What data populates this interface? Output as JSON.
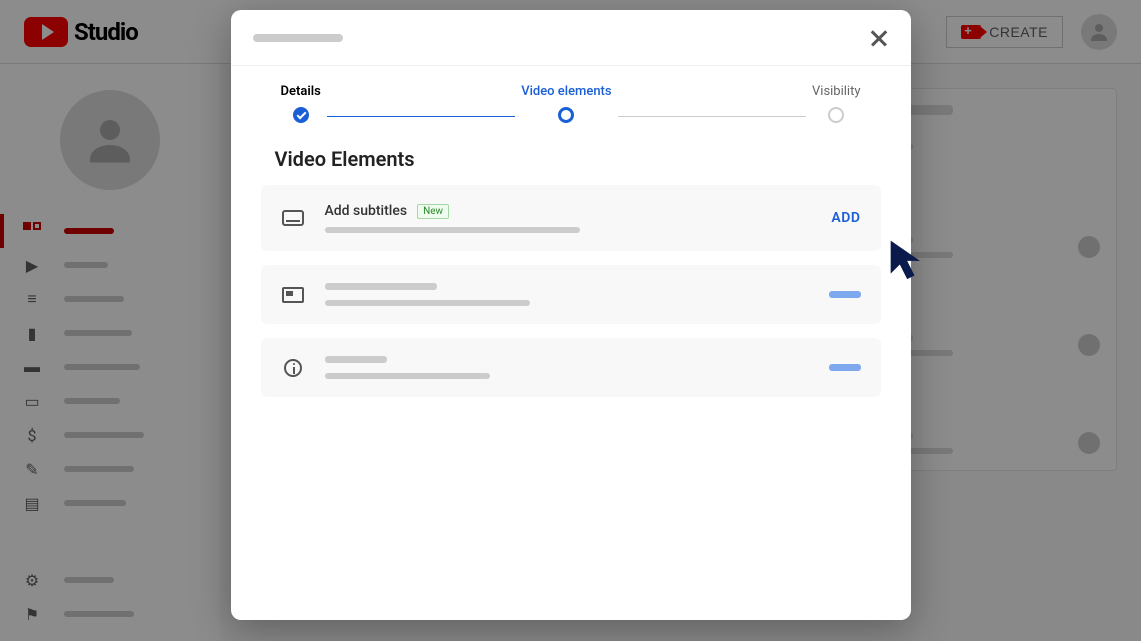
{
  "brand": {
    "studio_label": "Studio"
  },
  "header": {
    "create_label": "CREATE"
  },
  "modal": {
    "stepper": {
      "details": "Details",
      "video_elements": "Video elements",
      "visibility": "Visibility"
    },
    "section_title": "Video Elements",
    "elements": {
      "subtitles": {
        "title": "Add subtitles",
        "badge": "New",
        "action": "ADD"
      }
    }
  }
}
